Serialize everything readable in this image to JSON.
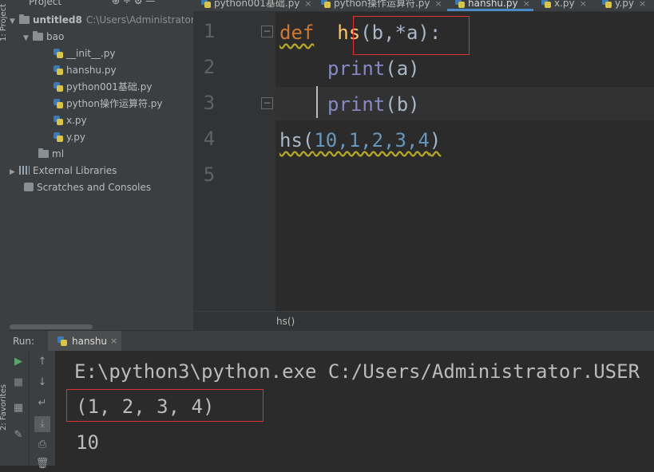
{
  "project_panel": {
    "title": "Project",
    "tools": "⊕ ÷ ⚙ —",
    "side_label": "1: Project",
    "favorites_label": "2: Favorites",
    "tree": [
      {
        "label": "untitled8",
        "path": "C:\\Users\\Administrator",
        "type": "folder",
        "expanded": true
      },
      {
        "label": "bao",
        "type": "folder",
        "expanded": true
      },
      {
        "label": "__init__.py",
        "type": "py"
      },
      {
        "label": "hanshu.py",
        "type": "py"
      },
      {
        "label": "python001基础.py",
        "type": "py"
      },
      {
        "label": "python操作运算符.py",
        "type": "py"
      },
      {
        "label": "x.py",
        "type": "py"
      },
      {
        "label": "y.py",
        "type": "py"
      },
      {
        "label": "ml",
        "type": "folder",
        "expanded": false
      },
      {
        "label": "External Libraries",
        "type": "lib",
        "expanded": false
      },
      {
        "label": "Scratches and Consoles",
        "type": "scratch"
      }
    ]
  },
  "editor_tabs": [
    {
      "label": "python001基础.py",
      "active": false
    },
    {
      "label": "python操作运算符.py",
      "active": false
    },
    {
      "label": "hanshu.py",
      "active": true
    },
    {
      "label": "x.py",
      "active": false
    },
    {
      "label": "y.py",
      "active": false
    }
  ],
  "editor": {
    "line_numbers": [
      "1",
      "2",
      "3",
      "4",
      "5"
    ],
    "line1": {
      "kw": "def",
      "fn": "hs",
      "args": "(b,*a):"
    },
    "line2": {
      "bi": "print",
      "args": "(a)"
    },
    "line3": {
      "bi": "print",
      "args": "(b)"
    },
    "line4": {
      "call": "hs(",
      "nums": "10,1,2,3,4",
      "close": ")"
    }
  },
  "breadcrumb": "hs()",
  "run": {
    "label": "Run:",
    "tab": "hanshu",
    "console": [
      "E:\\python3\\python.exe C:/Users/Administrator.USER",
      "(1, 2, 3, 4)",
      "10"
    ]
  },
  "colors": {
    "keyword": "#cc7832",
    "function": "#ffc66d",
    "builtin": "#8888c6",
    "number": "#6897bb",
    "highlight_box": "#e03030",
    "active_tab": "#4a88c7"
  }
}
